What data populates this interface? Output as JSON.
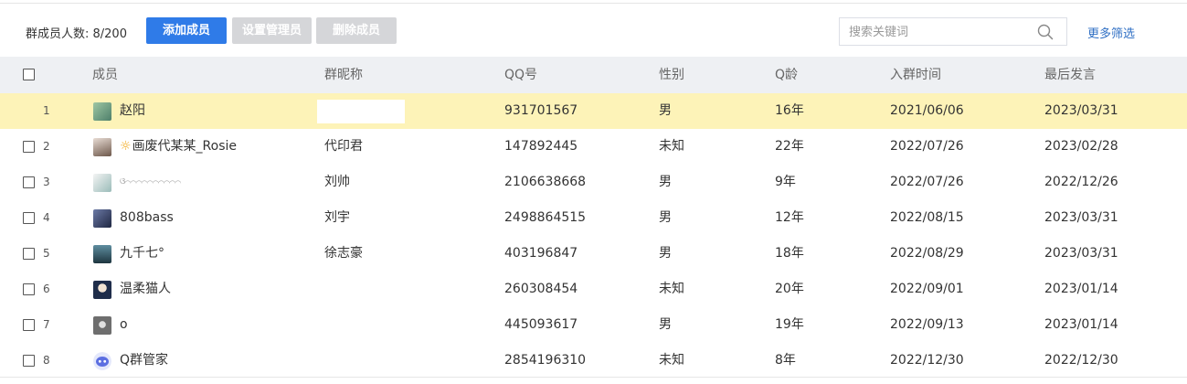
{
  "toolbar": {
    "member_count": "群成员人数: 8/200",
    "add_member": "添加成员",
    "set_admin": "设置管理员",
    "delete_member": "删除成员",
    "search_placeholder": "搜索关键词",
    "more_filter": "更多筛选"
  },
  "table": {
    "headers": {
      "member": "成员",
      "nickname": "群昵称",
      "qq": "QQ号",
      "gender": "性别",
      "qage": "Q龄",
      "join_time": "入群时间",
      "last_speak": "最后发言"
    },
    "rows": [
      {
        "index": "1",
        "name": "赵阳",
        "nickname": "",
        "qq": "931701567",
        "gender": "男",
        "qage": "16年",
        "join": "2021/06/06",
        "last": "2023/03/31",
        "avatar_color": "#6f9a7a"
      },
      {
        "index": "2",
        "name": "画废代某某_Rosie",
        "name_prefix": "☼",
        "nickname": "代印君",
        "qq": "147892445",
        "gender": "未知",
        "qage": "22年",
        "join": "2022/07/26",
        "last": "2023/02/28",
        "avatar_color": "#8a7466"
      },
      {
        "index": "3",
        "name": "ଓ⌒⌒⌒⌒⌒⌒⌒⌒⌒⌒",
        "nickname": "刘帅",
        "qq": "2106638668",
        "gender": "男",
        "qage": "9年",
        "join": "2022/07/26",
        "last": "2022/12/26",
        "avatar_color": "#a9c6c4"
      },
      {
        "index": "4",
        "name": "808bass",
        "nickname": "刘宇",
        "qq": "2498864515",
        "gender": "男",
        "qage": "12年",
        "join": "2022/08/15",
        "last": "2023/03/31",
        "avatar_color": "#3e4c6e"
      },
      {
        "index": "5",
        "name": "九千七°",
        "nickname": "徐志豪",
        "qq": "403196847",
        "gender": "男",
        "qage": "18年",
        "join": "2022/08/29",
        "last": "2023/03/31",
        "avatar_color": "#355a6b"
      },
      {
        "index": "6",
        "name": "温柔猫人",
        "nickname": "",
        "qq": "260308454",
        "gender": "未知",
        "qage": "20年",
        "join": "2022/09/01",
        "last": "2023/01/14",
        "avatar_color": "#2c3b55"
      },
      {
        "index": "7",
        "name": "o",
        "nickname": "",
        "qq": "445093617",
        "gender": "男",
        "qage": "19年",
        "join": "2022/09/13",
        "last": "2023/01/14",
        "avatar_color": "#7d7d7d"
      },
      {
        "index": "8",
        "name": "Q群管家",
        "nickname": "",
        "qq": "2854196310",
        "gender": "未知",
        "qage": "8年",
        "join": "2022/12/30",
        "last": "2022/12/30",
        "avatar_color": "#6f7fe0"
      }
    ]
  },
  "colors": {
    "primary": "#2f7be8",
    "disabled": "#d5d6d9",
    "highlight_row": "#fdf3b8",
    "header_bg": "#eef0f3",
    "link": "#2f6fc4"
  },
  "icons": {
    "search": "search-icon",
    "checkbox": "checkbox-icon"
  }
}
